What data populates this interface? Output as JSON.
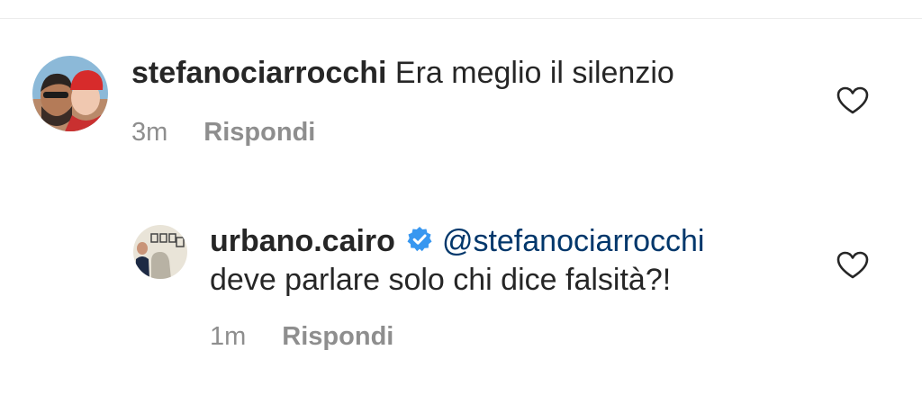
{
  "comment": {
    "username": "stefanociarrocchi",
    "text": "Era meglio il silenzio",
    "time": "3m",
    "reply_label": "Rispondi"
  },
  "reply": {
    "username": "urbano.cairo",
    "mention": "@stefanociarrocchi",
    "text": "deve parlare solo chi dice falsità?!",
    "time": "1m",
    "reply_label": "Rispondi"
  },
  "colors": {
    "verified": "#3897f0",
    "mention": "#00376b",
    "muted": "#8e8e8e"
  },
  "icons": {
    "like": "heart-outline-icon",
    "verified": "verified-badge-icon"
  }
}
